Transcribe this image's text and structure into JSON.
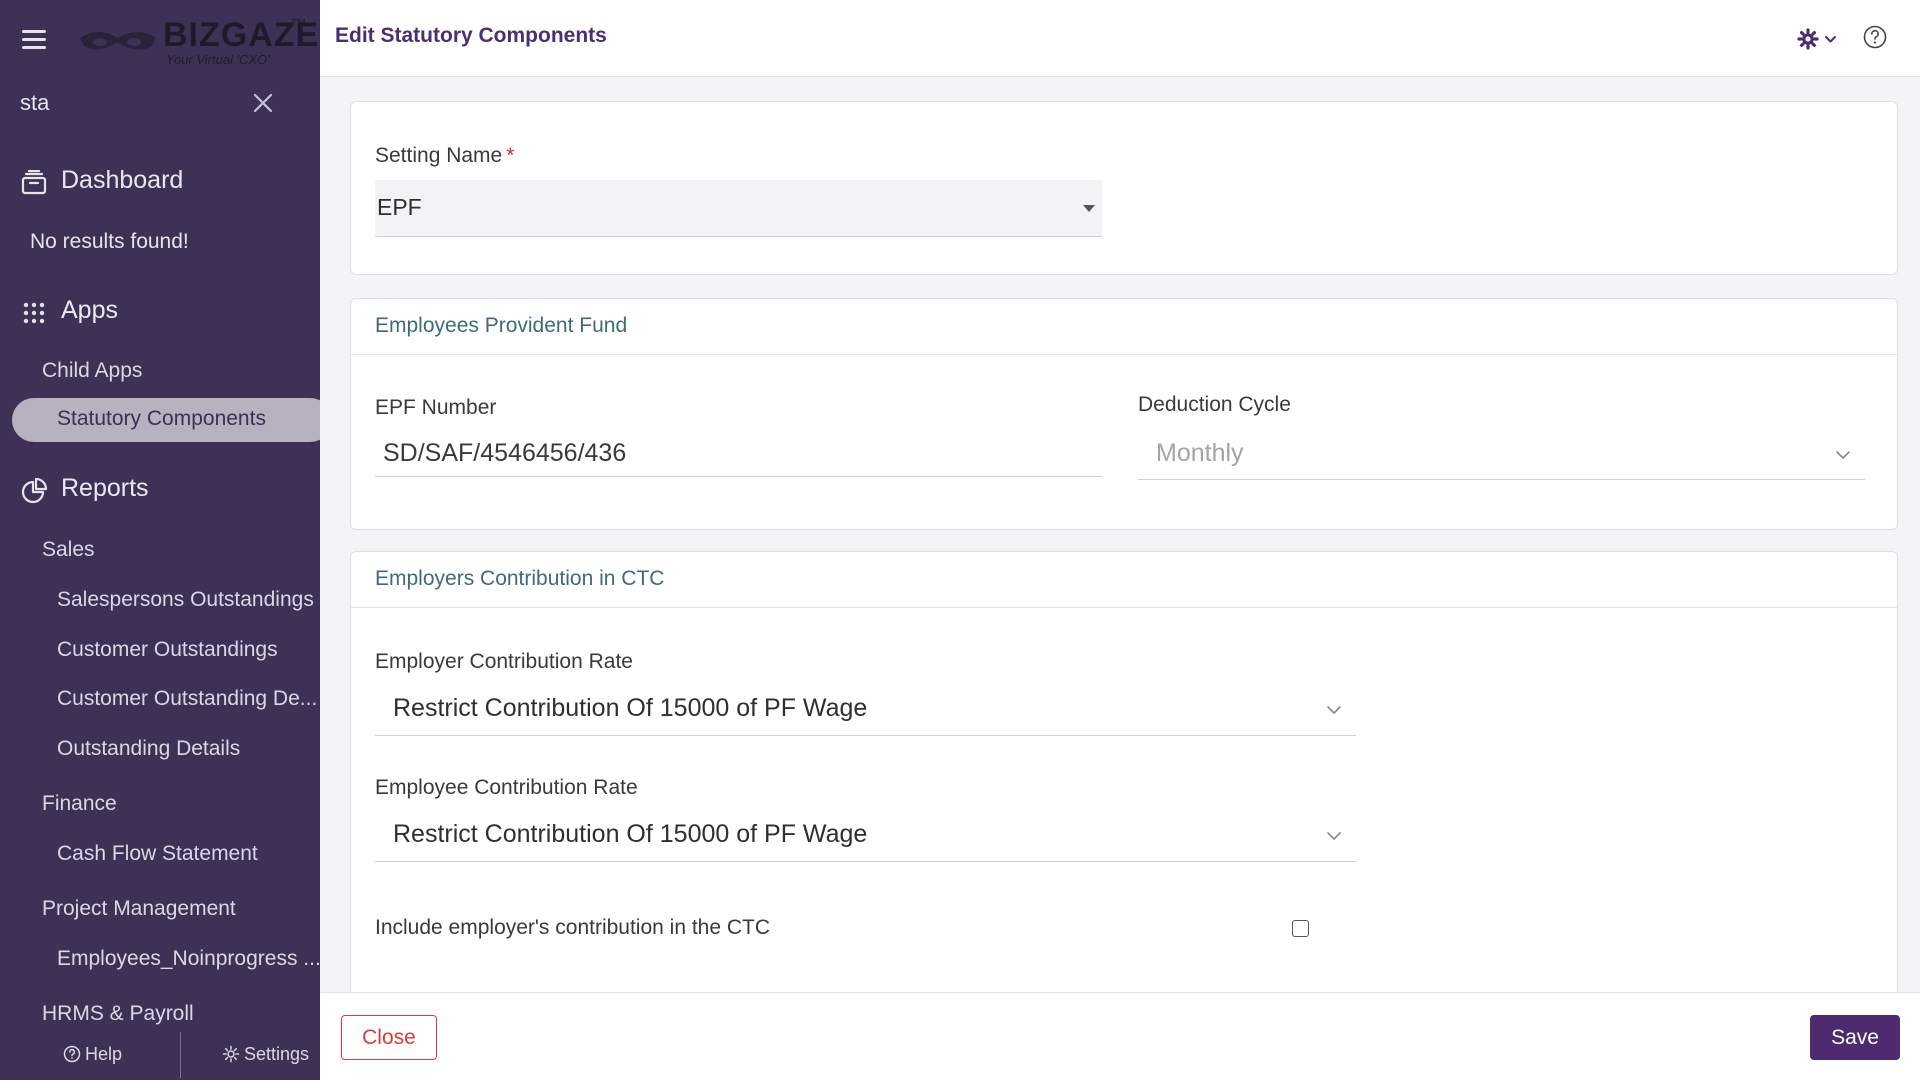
{
  "brand": {
    "name": "BIZGAZE",
    "tagline": "Your Virtual 'CXO'",
    "trademark": "TM"
  },
  "sidebar": {
    "search_value": "sta",
    "dashboard_label": "Dashboard",
    "no_results": "No results found!",
    "apps_label": "Apps",
    "apps_items": [
      {
        "label": "Child Apps"
      },
      {
        "label": "Statutory Components"
      }
    ],
    "reports_label": "Reports",
    "report_groups": [
      {
        "label": "Sales",
        "items": [
          "Salespersons Outstandings",
          "Customer Outstandings",
          "Customer Outstanding De...",
          "Outstanding Details"
        ]
      },
      {
        "label": "Finance",
        "items": [
          "Cash Flow Statement"
        ]
      },
      {
        "label": "Project Management",
        "items": [
          "Employees_Noinprogress ..."
        ]
      },
      {
        "label": "HRMS & Payroll",
        "items": []
      }
    ],
    "help_label": "Help",
    "settings_label": "Settings"
  },
  "header": {
    "title": "Edit Statutory Components"
  },
  "form": {
    "setting_name": {
      "label": "Setting Name",
      "required_mark": "*",
      "value": "EPF"
    },
    "epf_section": {
      "title": "Employees Provident Fund",
      "epf_number_label": "EPF Number",
      "epf_number_value": "SD/SAF/4546456/436",
      "deduction_cycle_label": "Deduction Cycle",
      "deduction_cycle_value": "Monthly"
    },
    "ctc_section": {
      "title": "Employers Contribution in CTC",
      "employer_rate_label": "Employer Contribution Rate",
      "employer_rate_value": "Restrict Contribution Of 15000 of PF Wage",
      "employee_rate_label": "Employee Contribution Rate",
      "employee_rate_value": "Restrict Contribution Of 15000 of PF Wage",
      "include_ctc_label": "Include employer's contribution in the CTC",
      "include_ctc_checked": false
    }
  },
  "actions": {
    "close_label": "Close",
    "save_label": "Save"
  },
  "colors": {
    "sidebar_bg": "#3f3155",
    "accent": "#4e2a6e",
    "title": "#4c2e72",
    "section_title": "#3e6a7c",
    "close_border": "#d83b3b"
  }
}
